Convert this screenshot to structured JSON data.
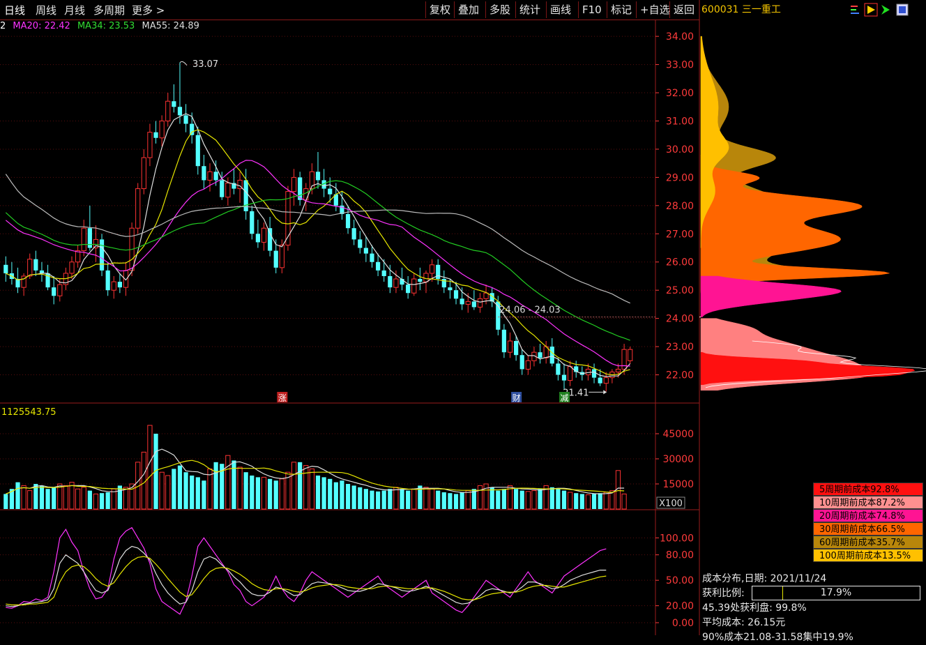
{
  "toolbar": {
    "period_tabs": [
      "日线",
      "周线",
      "月线",
      "多周期",
      "更多"
    ],
    "buttons": [
      "复权",
      "叠加",
      "多股",
      "统计",
      "画线",
      "F10",
      "标记",
      "+自选",
      "返回"
    ]
  },
  "stock": {
    "code": "600031",
    "name": "三一重工"
  },
  "ma_legend": [
    {
      "text": "2",
      "color": "#ffffff"
    },
    {
      "text": "MA20: 22.42",
      "color": "#ff33ff"
    },
    {
      "text": "MA34: 23.53",
      "color": "#33dd33"
    },
    {
      "text": "MA55: 24.89",
      "color": "#dddddd"
    }
  ],
  "colors": {
    "up": "#ff3333",
    "down": "#54ffff",
    "ma_white": "#e0e0e0",
    "ma_yellow": "#e6e600",
    "ma_magenta": "#ff33ff",
    "ma_green": "#22cc22",
    "ma_gray": "#bbbbbb",
    "axis": "#ff3b3b",
    "grid": "#5a0e0e"
  },
  "annotations": {
    "high_label": "33.07",
    "low_label": "21.41",
    "range_label": "24.06 - 24.03",
    "events": [
      "涨",
      "财",
      "减"
    ]
  },
  "volume_label": "1125543.75",
  "volume_multiplier": "X100",
  "chart_data": [
    {
      "type": "candlestick",
      "title": "",
      "ylim": [
        21.0,
        34.3
      ],
      "yticks": [
        "34.00",
        "33.00",
        "32.00",
        "31.00",
        "30.00",
        "29.00",
        "28.00",
        "27.00",
        "26.00",
        "25.00",
        "24.00",
        "23.00",
        "22.00"
      ],
      "high": 33.07,
      "low": 21.41,
      "candles": [
        [
          25.9,
          26.2,
          25.3,
          25.6
        ],
        [
          25.6,
          26.0,
          25.2,
          25.4
        ],
        [
          25.4,
          25.8,
          24.9,
          25.1
        ],
        [
          25.1,
          25.6,
          24.8,
          25.5
        ],
        [
          25.5,
          26.3,
          25.4,
          26.1
        ],
        [
          26.1,
          26.4,
          25.5,
          25.7
        ],
        [
          25.7,
          26.0,
          25.3,
          25.6
        ],
        [
          25.6,
          25.9,
          25.0,
          25.1
        ],
        [
          25.1,
          25.5,
          24.5,
          24.8
        ],
        [
          24.8,
          25.4,
          24.6,
          25.2
        ],
        [
          25.2,
          25.8,
          25.0,
          25.6
        ],
        [
          25.6,
          26.2,
          25.4,
          26.0
        ],
        [
          26.0,
          26.6,
          25.8,
          26.4
        ],
        [
          26.4,
          27.5,
          26.2,
          27.2
        ],
        [
          27.2,
          28.0,
          26.4,
          26.5
        ],
        [
          26.5,
          27.3,
          26.0,
          26.8
        ],
        [
          26.8,
          27.0,
          25.5,
          25.7
        ],
        [
          25.7,
          26.0,
          24.8,
          25.0
        ],
        [
          25.0,
          25.5,
          24.7,
          25.3
        ],
        [
          25.3,
          25.6,
          24.9,
          25.1
        ],
        [
          25.1,
          26.0,
          24.8,
          25.7
        ],
        [
          25.7,
          27.4,
          25.5,
          27.2
        ],
        [
          27.2,
          28.8,
          27.0,
          28.6
        ],
        [
          28.6,
          30.0,
          28.4,
          29.7
        ],
        [
          29.7,
          30.9,
          29.4,
          30.6
        ],
        [
          30.6,
          31.0,
          30.2,
          30.4
        ],
        [
          30.4,
          31.2,
          30.1,
          31.0
        ],
        [
          31.0,
          32.0,
          30.8,
          31.7
        ],
        [
          31.7,
          32.3,
          31.3,
          31.5
        ],
        [
          31.5,
          33.07,
          30.9,
          31.2
        ],
        [
          31.2,
          31.6,
          30.6,
          30.9
        ],
        [
          30.9,
          31.3,
          30.2,
          30.5
        ],
        [
          30.5,
          30.8,
          29.1,
          29.4
        ],
        [
          29.4,
          29.8,
          28.6,
          28.9
        ],
        [
          28.9,
          29.5,
          28.5,
          29.2
        ],
        [
          29.2,
          29.6,
          28.7,
          28.9
        ],
        [
          28.9,
          29.2,
          28.2,
          28.3
        ],
        [
          28.3,
          29.0,
          28.0,
          28.8
        ],
        [
          28.8,
          29.3,
          28.4,
          28.6
        ],
        [
          28.6,
          29.2,
          28.1,
          28.9
        ],
        [
          28.9,
          29.3,
          27.5,
          27.8
        ],
        [
          27.8,
          28.0,
          26.8,
          27.0
        ],
        [
          27.0,
          27.5,
          26.5,
          26.7
        ],
        [
          26.7,
          27.4,
          26.4,
          27.2
        ],
        [
          27.2,
          27.6,
          26.2,
          26.4
        ],
        [
          26.4,
          26.8,
          25.6,
          25.8
        ],
        [
          25.8,
          26.8,
          25.6,
          26.6
        ],
        [
          26.6,
          28.7,
          26.4,
          28.5
        ],
        [
          28.5,
          29.3,
          28.0,
          29.0
        ],
        [
          29.0,
          29.2,
          28.0,
          28.2
        ],
        [
          28.2,
          28.8,
          27.8,
          28.6
        ],
        [
          28.6,
          29.5,
          28.4,
          29.2
        ],
        [
          29.2,
          29.9,
          28.6,
          28.9
        ],
        [
          28.9,
          29.3,
          28.3,
          28.6
        ],
        [
          28.6,
          29.0,
          28.1,
          28.4
        ],
        [
          28.4,
          28.8,
          27.8,
          28.0
        ],
        [
          28.0,
          28.5,
          27.5,
          27.7
        ],
        [
          27.7,
          28.0,
          27.0,
          27.2
        ],
        [
          27.2,
          27.5,
          26.6,
          26.8
        ],
        [
          26.8,
          27.1,
          26.3,
          26.5
        ],
        [
          26.5,
          26.9,
          26.0,
          26.3
        ],
        [
          26.3,
          26.6,
          25.8,
          26.0
        ],
        [
          26.0,
          26.3,
          25.5,
          25.7
        ],
        [
          25.7,
          26.1,
          25.3,
          25.5
        ],
        [
          25.5,
          25.9,
          24.9,
          25.1
        ],
        [
          25.1,
          25.7,
          24.9,
          25.4
        ],
        [
          25.4,
          25.8,
          25.0,
          25.2
        ],
        [
          25.2,
          25.5,
          24.7,
          24.9
        ],
        [
          24.9,
          25.6,
          24.8,
          25.4
        ],
        [
          25.4,
          25.8,
          25.0,
          25.3
        ],
        [
          25.3,
          25.7,
          24.9,
          25.6
        ],
        [
          25.6,
          26.1,
          25.3,
          25.9
        ],
        [
          25.9,
          26.1,
          25.2,
          25.4
        ],
        [
          25.4,
          25.7,
          24.9,
          25.1
        ],
        [
          25.1,
          25.4,
          24.7,
          25.0
        ],
        [
          25.0,
          25.3,
          24.5,
          24.7
        ],
        [
          24.7,
          25.1,
          24.3,
          24.5
        ],
        [
          24.5,
          24.9,
          24.2,
          24.6
        ],
        [
          24.6,
          25.0,
          24.3,
          24.4
        ],
        [
          24.4,
          24.9,
          24.2,
          24.7
        ],
        [
          24.7,
          25.2,
          24.5,
          24.9
        ],
        [
          24.9,
          25.1,
          24.4,
          24.6
        ],
        [
          24.6,
          24.8,
          23.4,
          23.6
        ],
        [
          23.6,
          23.8,
          22.6,
          22.8
        ],
        [
          22.8,
          23.5,
          22.6,
          23.2
        ],
        [
          23.2,
          23.4,
          22.5,
          22.7
        ],
        [
          22.7,
          22.9,
          22.0,
          22.2
        ],
        [
          22.2,
          22.7,
          22.0,
          22.5
        ],
        [
          22.5,
          23.0,
          22.3,
          22.8
        ],
        [
          22.8,
          23.1,
          22.4,
          22.6
        ],
        [
          22.6,
          23.2,
          22.4,
          23.0
        ],
        [
          23.0,
          23.3,
          22.3,
          22.4
        ],
        [
          22.4,
          22.6,
          21.8,
          22.0
        ],
        [
          22.0,
          22.4,
          21.5,
          21.8
        ],
        [
          21.8,
          22.5,
          21.6,
          22.3
        ],
        [
          22.3,
          22.5,
          21.9,
          22.1
        ],
        [
          22.1,
          22.3,
          21.8,
          22.0
        ],
        [
          22.0,
          22.4,
          21.8,
          22.2
        ],
        [
          22.2,
          22.4,
          21.7,
          21.9
        ],
        [
          21.9,
          22.2,
          21.6,
          21.7
        ],
        [
          21.7,
          22.1,
          21.41,
          21.9
        ],
        [
          21.9,
          22.2,
          21.7,
          22.1
        ],
        [
          22.1,
          22.4,
          21.9,
          22.2
        ],
        [
          22.2,
          23.1,
          22.0,
          22.9
        ],
        [
          22.5,
          23.0,
          22.4,
          22.9
        ]
      ],
      "ma_series": [
        {
          "name": "MA20",
          "color": "#ff33ff"
        },
        {
          "name": "MA34",
          "color": "#33dd33"
        },
        {
          "name": "MA55",
          "color": "#dddddd"
        }
      ]
    },
    {
      "type": "bar",
      "title": "",
      "ylim": [
        0,
        55000
      ],
      "yticks": [
        "45000",
        "30000",
        "15000"
      ],
      "values": [
        9000,
        12000,
        16000,
        14000,
        11000,
        15000,
        14000,
        12000,
        13000,
        15000,
        14000,
        16000,
        12000,
        13000,
        11000,
        9000,
        9500,
        10000,
        12000,
        14000,
        13000,
        15000,
        28000,
        34000,
        50000,
        45000,
        22000,
        20000,
        24000,
        26000,
        22000,
        20000,
        19000,
        17000,
        24000,
        28000,
        27000,
        32000,
        29000,
        25000,
        22000,
        20000,
        19000,
        19000,
        18000,
        17000,
        18000,
        22000,
        28000,
        28000,
        26000,
        24000,
        20000,
        19000,
        18000,
        16000,
        17000,
        15000,
        14000,
        13000,
        12000,
        11000,
        10500,
        11000,
        12000,
        13000,
        12000,
        11000,
        12000,
        14000,
        13000,
        12000,
        11000,
        10000,
        9500,
        9000,
        10000,
        11000,
        12000,
        14000,
        15000,
        13000,
        11000,
        12000,
        14000,
        12000,
        11000,
        10500,
        11000,
        12000,
        14000,
        13000,
        12000,
        11000,
        10000,
        9500,
        9000,
        8500,
        9000,
        9500,
        10000,
        11000,
        23000,
        9000
      ],
      "volume_ma_visible": true
    },
    {
      "type": "line",
      "title": "",
      "ylim": [
        0,
        120
      ],
      "yticks": [
        "100.00",
        "80.00",
        "50.00",
        "20.00",
        "0.00"
      ],
      "series": [
        {
          "color": "#ff33ff",
          "values": [
            18,
            17,
            20,
            25,
            24,
            28,
            26,
            30,
            60,
            100,
            110,
            95,
            85,
            60,
            40,
            28,
            30,
            40,
            75,
            100,
            108,
            112,
            100,
            88,
            70,
            40,
            25,
            20,
            15,
            10,
            25,
            55,
            90,
            100,
            90,
            80,
            70,
            60,
            45,
            38,
            25,
            20,
            25,
            30,
            40,
            55,
            40,
            30,
            25,
            35,
            50,
            60,
            55,
            50,
            45,
            40,
            35,
            30,
            35,
            40,
            45,
            50,
            55,
            45,
            40,
            35,
            30,
            35,
            40,
            45,
            50,
            35,
            30,
            25,
            20,
            15,
            12,
            20,
            30,
            40,
            50,
            45,
            40,
            35,
            30,
            40,
            50,
            60,
            50,
            45,
            40,
            35,
            45,
            55,
            60,
            65,
            70,
            75,
            80,
            85,
            87
          ]
        },
        {
          "color": "#e0e0e0",
          "values": [
            20,
            19,
            20,
            22,
            23,
            24,
            25,
            27,
            40,
            70,
            80,
            75,
            70,
            60,
            48,
            38,
            35,
            38,
            55,
            75,
            85,
            90,
            88,
            82,
            74,
            58,
            45,
            35,
            28,
            22,
            24,
            38,
            60,
            75,
            78,
            75,
            68,
            62,
            54,
            48,
            40,
            34,
            32,
            32,
            36,
            42,
            40,
            36,
            32,
            33,
            40,
            46,
            48,
            47,
            46,
            44,
            41,
            38,
            37,
            37,
            39,
            42,
            46,
            45,
            43,
            41,
            38,
            37,
            38,
            40,
            43,
            40,
            36,
            32,
            28,
            24,
            22,
            23,
            27,
            32,
            38,
            40,
            39,
            37,
            35,
            37,
            42,
            48,
            48,
            46,
            43,
            40,
            41,
            45,
            50,
            53,
            56,
            58,
            60,
            62,
            62
          ]
        },
        {
          "color": "#e6e600",
          "values": [
            22,
            21,
            21,
            21,
            22,
            22,
            23,
            24,
            30,
            48,
            60,
            66,
            68,
            66,
            60,
            52,
            46,
            43,
            47,
            57,
            66,
            73,
            77,
            78,
            76,
            69,
            61,
            52,
            44,
            36,
            31,
            33,
            42,
            52,
            60,
            64,
            65,
            64,
            61,
            57,
            52,
            46,
            42,
            39,
            38,
            40,
            40,
            39,
            37,
            36,
            38,
            41,
            43,
            44,
            45,
            45,
            44,
            42,
            41,
            40,
            40,
            40,
            42,
            43,
            43,
            42,
            41,
            40,
            40,
            40,
            41,
            41,
            39,
            37,
            34,
            31,
            28,
            27,
            27,
            29,
            32,
            34,
            35,
            36,
            36,
            36,
            38,
            41,
            43,
            44,
            44,
            43,
            42,
            42,
            44,
            46,
            48,
            50,
            52,
            54,
            55
          ]
        }
      ]
    },
    {
      "type": "area",
      "title": "成本分布",
      "date": "2021/11/24",
      "legend": [
        {
          "label": "5周期前成本92.8%",
          "color": "#ff1010"
        },
        {
          "label": "10周期前成本87.2%",
          "color": "#ff8080"
        },
        {
          "label": "20周期前成本74.8%",
          "color": "#ff1493"
        },
        {
          "label": "30周期前成本66.5%",
          "color": "#ff6600"
        },
        {
          "label": "60周期前成本35.7%",
          "color": "#b8860b"
        },
        {
          "label": "100周期前成本13.5%",
          "color": "#ffc000"
        }
      ]
    }
  ],
  "cyq": {
    "title_line": "成本分布,日期: 2021/11/24",
    "profit_label": "获利比例:",
    "profit_value": "17.9%",
    "profit_fraction": 0.179,
    "line2": "45.39处获利盘: 99.8%",
    "line3": "平均成本: 26.15元",
    "line4": "90%成本21.08-31.58集中19.9%"
  }
}
